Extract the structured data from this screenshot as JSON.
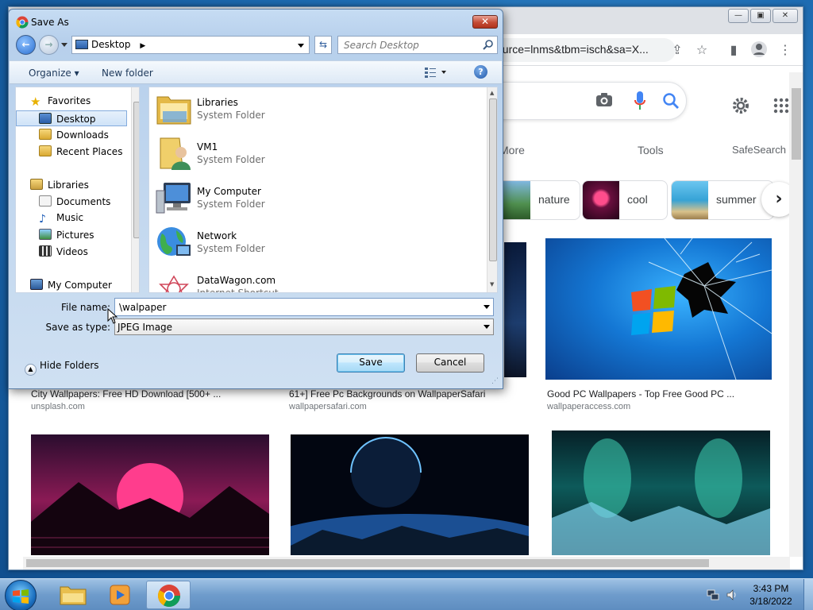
{
  "browser": {
    "omnibox_url": "ource=lnms&tbm=isch&sa=X...",
    "tabs": {
      "more": "More",
      "tools": "Tools",
      "safesearch": "SafeSearch o"
    },
    "chips": [
      {
        "label": "nature",
        "color": "#4e9a63"
      },
      {
        "label": "cool",
        "color": "#c02a67"
      },
      {
        "label": "summer",
        "color": "#3a9ad0"
      }
    ],
    "results": [
      {
        "caption": "City Wallpapers: Free HD Download [500+ ...",
        "source": "unsplash.com"
      },
      {
        "caption": "61+] Free Pc Backgrounds on WallpaperSafari",
        "source": "wallpapersafari.com"
      },
      {
        "caption": "Good PC Wallpapers - Top Free Good PC ...",
        "source": "wallpaperaccess.com"
      }
    ]
  },
  "dialog": {
    "title": "Save As",
    "address": "Desktop",
    "search_placeholder": "Search Desktop",
    "toolbar": {
      "organize": "Organize",
      "new_folder": "New folder"
    },
    "nav": {
      "favorites": "Favorites",
      "desktop": "Desktop",
      "downloads": "Downloads",
      "recent": "Recent Places",
      "libraries": "Libraries",
      "documents": "Documents",
      "music": "Music",
      "pictures": "Pictures",
      "videos": "Videos",
      "my_computer": "My Computer"
    },
    "files": [
      {
        "name": "Libraries",
        "type": "System Folder"
      },
      {
        "name": "VM1",
        "type": "System Folder"
      },
      {
        "name": "My Computer",
        "type": "System Folder"
      },
      {
        "name": "Network",
        "type": "System Folder"
      },
      {
        "name": "DataWagon.com",
        "type": "Internet Shortcut"
      }
    ],
    "file_name_label": "File name:",
    "file_name_value": "\\walpaper",
    "save_type_label": "Save as type:",
    "save_type_value": "JPEG Image",
    "save_button": "Save",
    "cancel_button": "Cancel",
    "hide_folders": "Hide Folders"
  },
  "taskbar": {
    "time": "3:43 PM",
    "date": "3/18/2022"
  }
}
